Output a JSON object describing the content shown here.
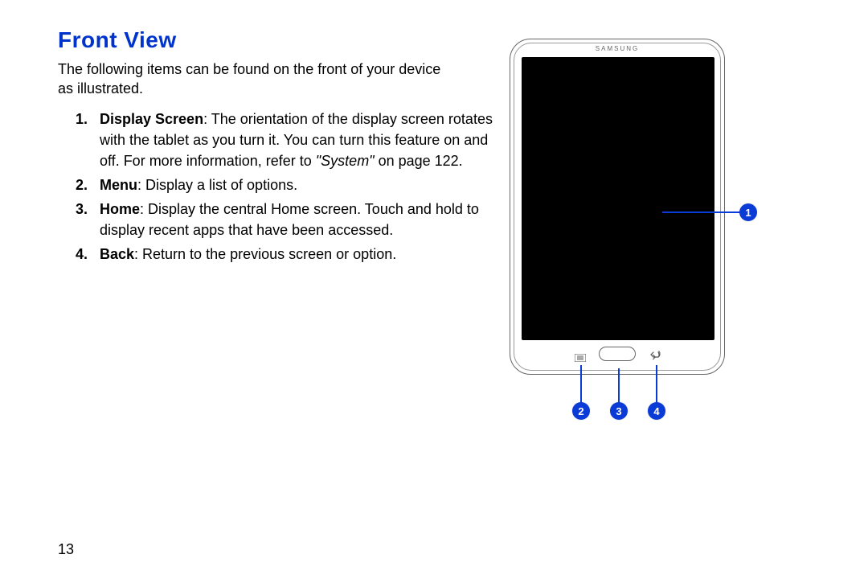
{
  "heading": "Front View",
  "intro": "The following items can be found on the front of your device as illustrated.",
  "items": [
    {
      "label": "Display Screen",
      "text": ": The orientation of the display screen rotates with the tablet as you turn it. You can turn this feature on and off. For more information, refer to ",
      "ref": "\"System\"",
      "after_ref": " on page 122."
    },
    {
      "label": "Menu",
      "text": ": Display a list of options."
    },
    {
      "label": "Home",
      "text": ": Display the central Home screen. Touch and hold to display recent apps that have been accessed."
    },
    {
      "label": "Back",
      "text": ": Return to the previous screen or option."
    }
  ],
  "page_number": "13",
  "device": {
    "brand": "SAMSUNG"
  },
  "callouts": [
    "1",
    "2",
    "3",
    "4"
  ]
}
